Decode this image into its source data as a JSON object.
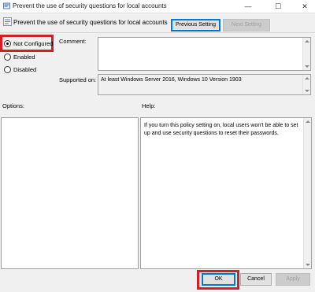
{
  "window": {
    "title": "Prevent the use of security questions for local accounts",
    "minimize": "—",
    "maximize": "☐",
    "close": "✕"
  },
  "header": {
    "policy_name": "Prevent the use of security questions for local accounts",
    "previous_setting": "Previous Setting",
    "next_setting": "Next Setting"
  },
  "state": {
    "options": [
      "Not Configured",
      "Enabled",
      "Disabled"
    ],
    "selected": "Not Configured"
  },
  "comment": {
    "label": "Comment:",
    "value": ""
  },
  "supported": {
    "label": "Supported on:",
    "value": "At least Windows Server 2016, Windows 10 Version 1903"
  },
  "options_pane": {
    "label": "Options:"
  },
  "help_pane": {
    "label": "Help:",
    "text": "If you turn this policy setting on, local users won't be able to set up and use security questions to reset their passwords."
  },
  "footer": {
    "ok": "OK",
    "cancel": "Cancel",
    "apply": "Apply"
  },
  "colors": {
    "highlight": "#d0202a",
    "focus": "#0078d7"
  }
}
